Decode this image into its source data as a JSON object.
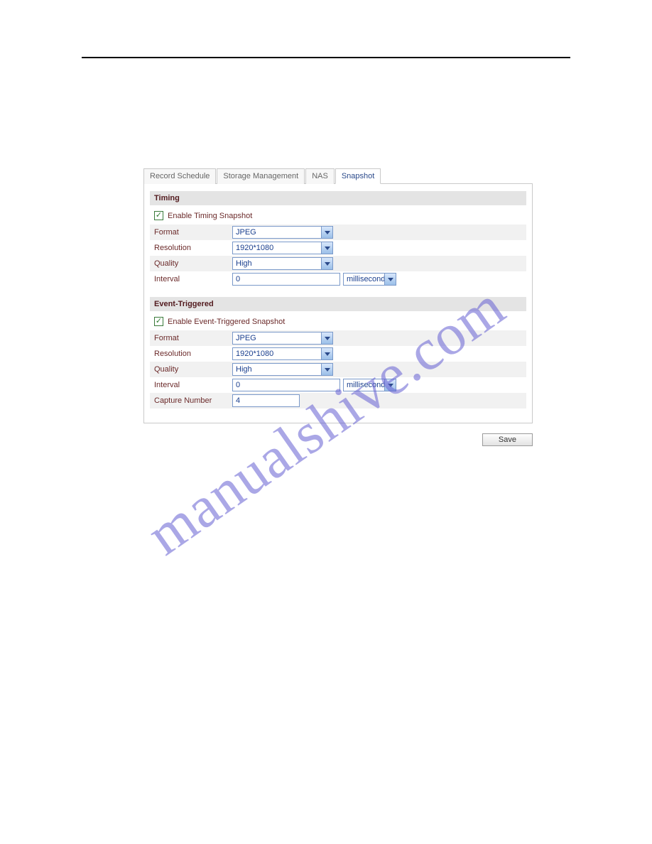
{
  "watermark": "manualshive.com",
  "tabs": {
    "t0": "Record Schedule",
    "t1": "Storage Management",
    "t2": "NAS",
    "t3": "Snapshot"
  },
  "timing": {
    "header": "Timing",
    "enable_label": "Enable Timing Snapshot",
    "format_label": "Format",
    "format_value": "JPEG",
    "resolution_label": "Resolution",
    "resolution_value": "1920*1080",
    "quality_label": "Quality",
    "quality_value": "High",
    "interval_label": "Interval",
    "interval_value": "0",
    "interval_unit": "millisecond"
  },
  "event": {
    "header": "Event-Triggered",
    "enable_label": "Enable Event-Triggered Snapshot",
    "format_label": "Format",
    "format_value": "JPEG",
    "resolution_label": "Resolution",
    "resolution_value": "1920*1080",
    "quality_label": "Quality",
    "quality_value": "High",
    "interval_label": "Interval",
    "interval_value": "0",
    "interval_unit": "millisecond",
    "capture_label": "Capture Number",
    "capture_value": "4"
  },
  "buttons": {
    "save": "Save"
  }
}
